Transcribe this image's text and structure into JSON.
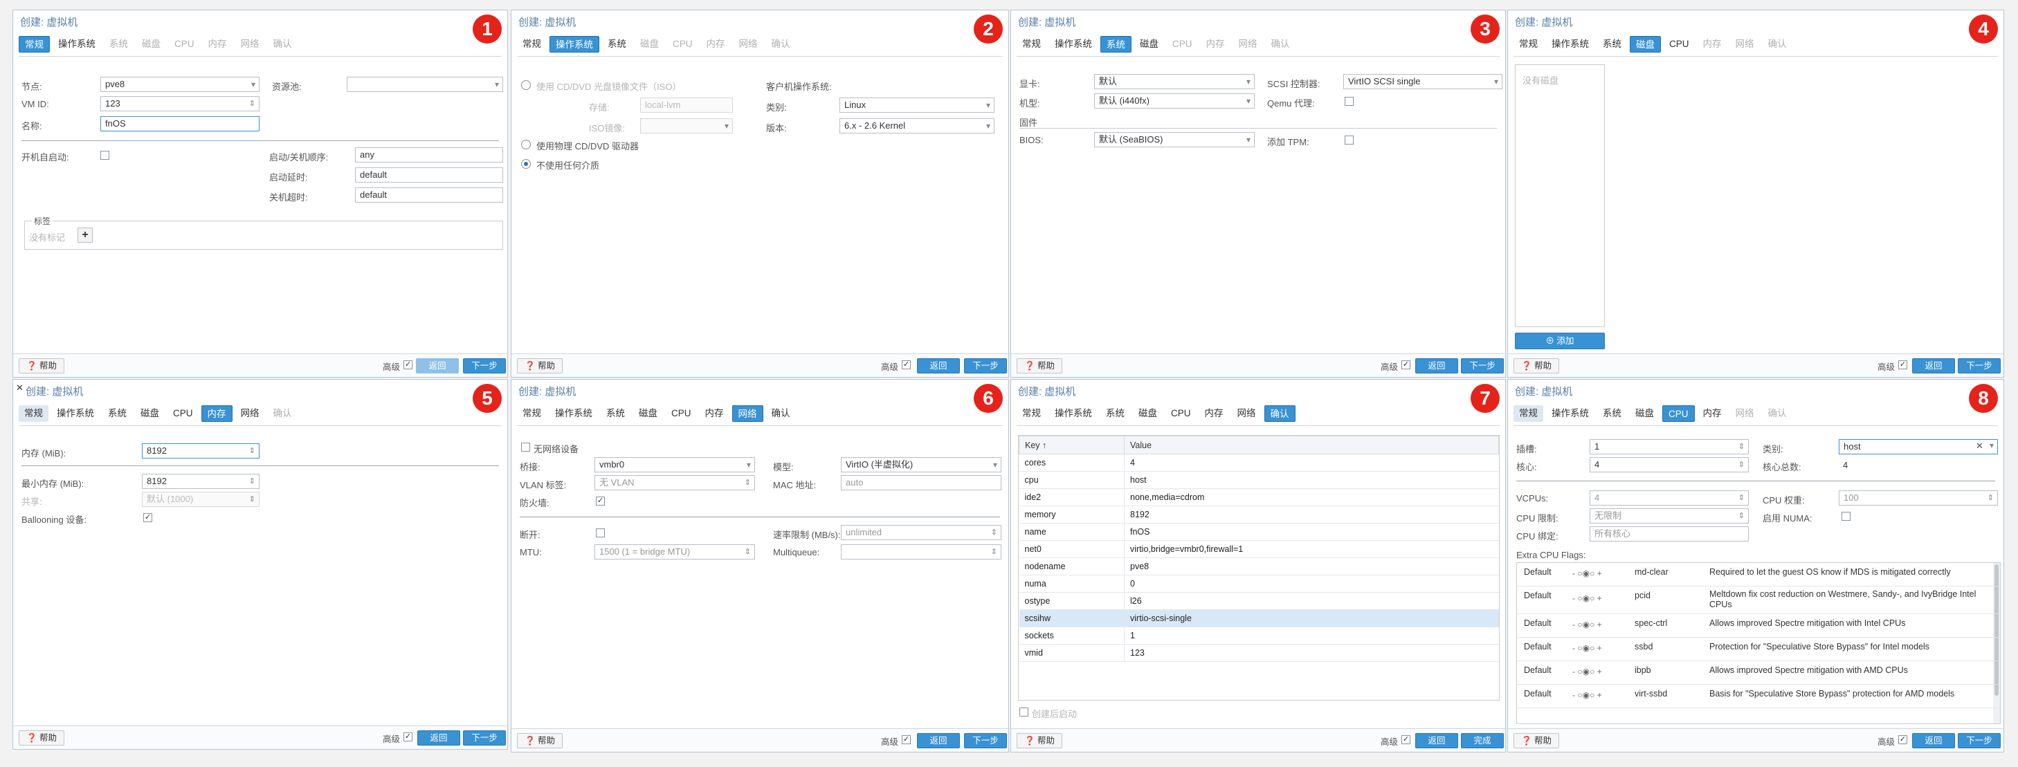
{
  "common": {
    "title": "创建: 虚拟机",
    "help": "帮助",
    "advanced": "高级",
    "back": "返回",
    "next": "下一步",
    "finish": "完成",
    "tabs": [
      "常规",
      "操作系统",
      "系统",
      "磁盘",
      "CPU",
      "内存",
      "网络",
      "确认"
    ]
  },
  "p1": {
    "badge": "1",
    "node_label": "节点:",
    "node_value": "pve8",
    "pool_label": "资源池:",
    "vmid_label": "VM ID:",
    "vmid_value": "123",
    "name_label": "名称:",
    "name_value": "fnOS",
    "onboot_label": "开机自启动:",
    "order_label": "启动/关机顺序:",
    "order_value": "any",
    "startup_delay_label": "启动延时:",
    "startup_delay_value": "default",
    "shutdown_timeout_label": "关机超时:",
    "shutdown_timeout_value": "default",
    "tags_legend": "标签",
    "no_tags": "没有标记"
  },
  "p2": {
    "badge": "2",
    "iso_label": "使用 CD/DVD 光盘镜像文件（ISO）",
    "storage_label": "存储:",
    "storage_value": "local-lvm",
    "isofile_label": "ISO镜像:",
    "physical_label": "使用物理 CD/DVD 驱动器",
    "none_label": "不使用任何介质",
    "guest_os_label": "客户机操作系统:",
    "type_label": "类别:",
    "type_value": "Linux",
    "version_label": "版本:",
    "version_value": "6.x - 2.6 Kernel"
  },
  "p3": {
    "badge": "3",
    "gpu_label": "显卡:",
    "gpu_value": "默认",
    "machine_label": "机型:",
    "machine_value": "默认 (i440fx)",
    "firmware_label": "固件",
    "bios_label": "BIOS:",
    "bios_value": "默认 (SeaBIOS)",
    "scsi_label": "SCSI 控制器:",
    "scsi_value": "VirtIO SCSI single",
    "qemu_label": "Qemu 代理:",
    "tpm_label": "添加 TPM:"
  },
  "p4": {
    "badge": "4",
    "no_disk": "没有磁盘",
    "add": "添加"
  },
  "p5": {
    "badge": "5",
    "mem_label": "内存 (MiB):",
    "mem_value": "8192",
    "minmem_label": "最小内存 (MiB):",
    "minmem_value": "8192",
    "shares_label": "共享:",
    "shares_value": "默认 (1000)",
    "balloon_label": "Ballooning 设备:"
  },
  "p6": {
    "badge": "6",
    "nonet_label": "无网络设备",
    "bridge_label": "桥接:",
    "bridge_value": "vmbr0",
    "vlan_label": "VLAN 标签:",
    "vlan_value": "无 VLAN",
    "firewall_label": "防火墙:",
    "model_label": "模型:",
    "model_value": "VirtIO (半虚拟化)",
    "mac_label": "MAC 地址:",
    "mac_value": "auto",
    "disconnect_label": "断开:",
    "mtu_label": "MTU:",
    "mtu_value": "1500 (1 = bridge MTU)",
    "rate_label": "速率限制 (MB/s):",
    "rate_value": "unlimited",
    "multiqueue_label": "Multiqueue:"
  },
  "p7": {
    "badge": "7",
    "key_header": "Key ↑",
    "value_header": "Value",
    "rows": [
      {
        "k": "cores",
        "v": "4"
      },
      {
        "k": "cpu",
        "v": "host"
      },
      {
        "k": "ide2",
        "v": "none,media=cdrom"
      },
      {
        "k": "memory",
        "v": "8192"
      },
      {
        "k": "name",
        "v": "fnOS"
      },
      {
        "k": "net0",
        "v": "virtio,bridge=vmbr0,firewall=1"
      },
      {
        "k": "nodename",
        "v": "pve8"
      },
      {
        "k": "numa",
        "v": "0"
      },
      {
        "k": "ostype",
        "v": "l26"
      },
      {
        "k": "scsihw",
        "v": "virtio-scsi-single"
      },
      {
        "k": "sockets",
        "v": "1"
      },
      {
        "k": "vmid",
        "v": "123"
      }
    ],
    "start_after": "创建后启动"
  },
  "p8": {
    "badge": "8",
    "sockets_label": "插槽:",
    "sockets_value": "1",
    "cores_label": "核心:",
    "cores_value": "4",
    "type_label": "类别:",
    "type_value": "host",
    "total_label": "核心总数:",
    "total_value": "4",
    "vcpus_label": "VCPUs:",
    "vcpus_value": "4",
    "cpuunits_label": "CPU 权重:",
    "cpuunits_value": "100",
    "cpulimit_label": "CPU 限制:",
    "cpulimit_value": "无限制",
    "numa_label": "启用 NUMA:",
    "affinity_label": "CPU 绑定:",
    "affinity_value": "所有核心",
    "flags_label": "Extra CPU Flags:",
    "flags": [
      {
        "d": "Default",
        "n": "md-clear",
        "desc": "Required to let the guest OS know if MDS is mitigated correctly"
      },
      {
        "d": "Default",
        "n": "pcid",
        "desc": "Meltdown fix cost reduction on Westmere, Sandy-, and IvyBridge Intel CPUs"
      },
      {
        "d": "Default",
        "n": "spec-ctrl",
        "desc": "Allows improved Spectre mitigation with Intel CPUs"
      },
      {
        "d": "Default",
        "n": "ssbd",
        "desc": "Protection for \"Speculative Store Bypass\" for Intel models"
      },
      {
        "d": "Default",
        "n": "ibpb",
        "desc": "Allows improved Spectre mitigation with AMD CPUs"
      },
      {
        "d": "Default",
        "n": "virt-ssbd",
        "desc": "Basis for \"Speculative Store Bypass\" protection for AMD models"
      }
    ]
  }
}
